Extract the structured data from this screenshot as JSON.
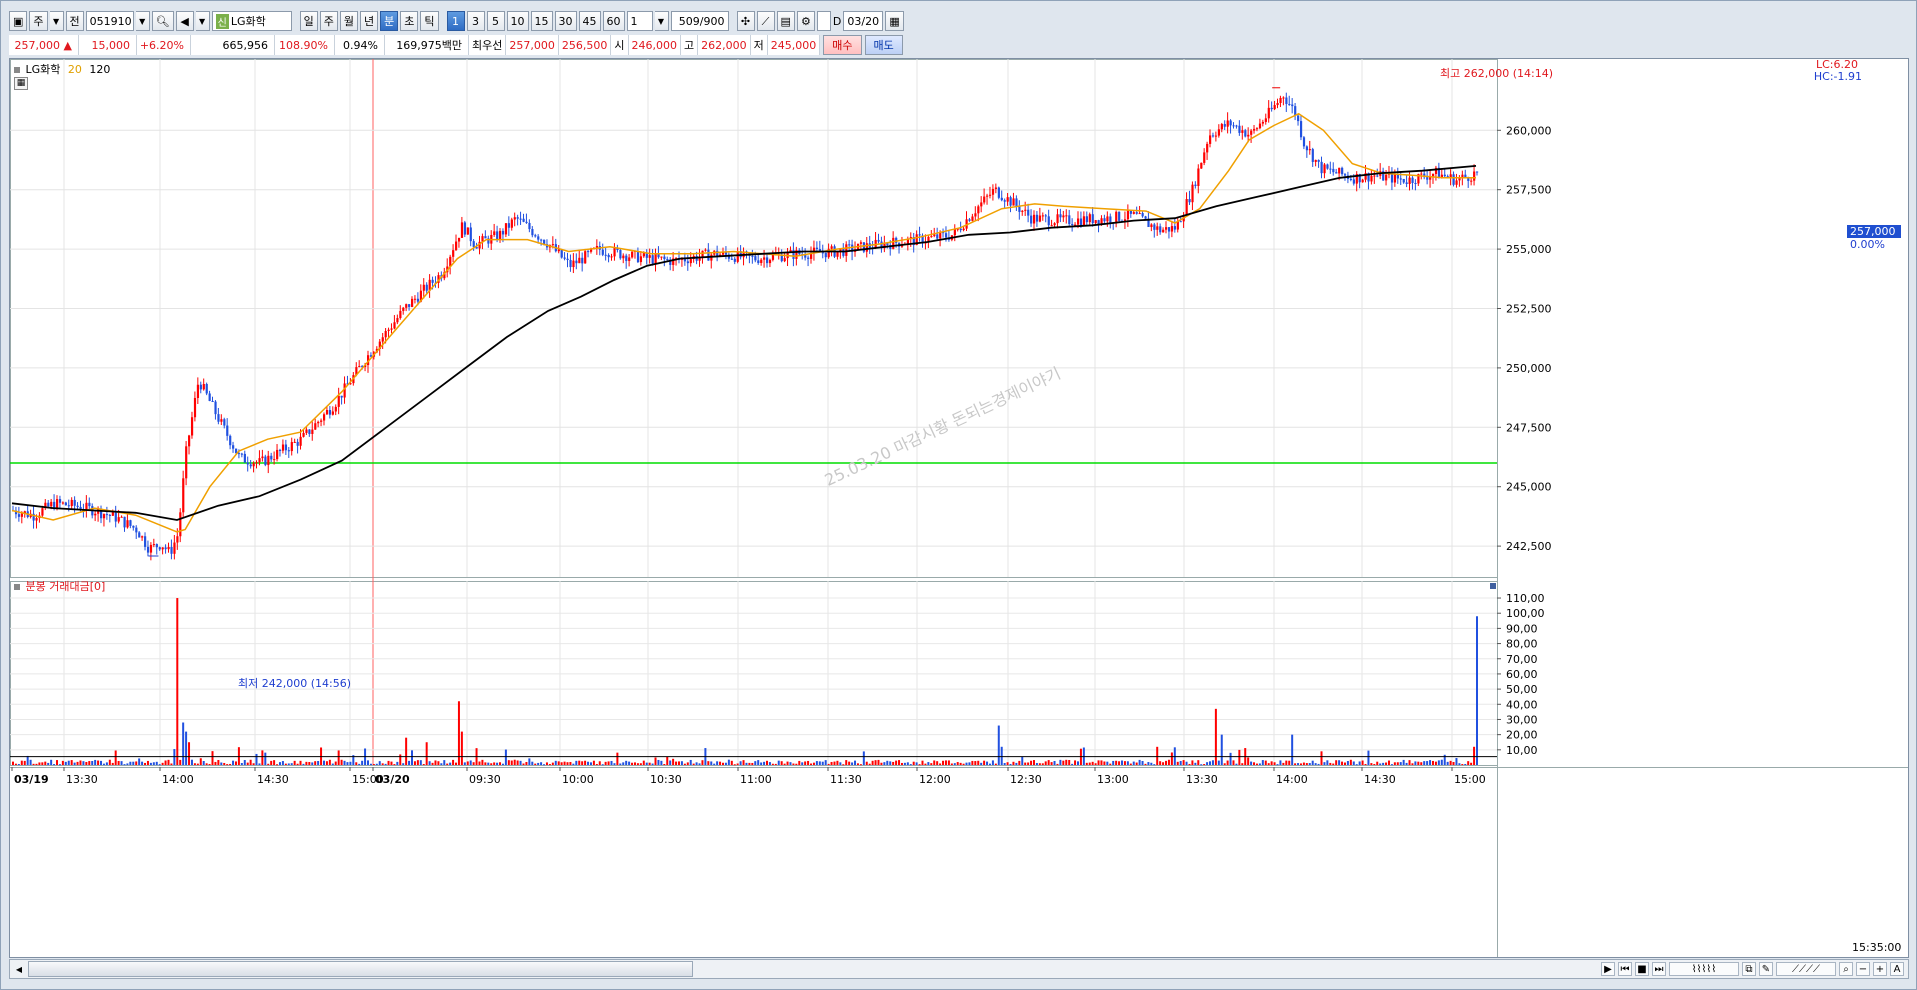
{
  "toolbar": {
    "mode_label": "주",
    "prev_label": "전",
    "stock_code": "051910",
    "stock_badge": "신",
    "stock_name": "LG화학",
    "period_buttons": [
      "일",
      "주",
      "월",
      "년",
      "분",
      "초",
      "틱"
    ],
    "selected_period": "분",
    "interval_buttons": [
      "1",
      "3",
      "5",
      "10",
      "15",
      "30",
      "45",
      "60"
    ],
    "selected_interval": "1",
    "multiplier_value": "1",
    "count_value": "509/900",
    "date_checkbox_label": "D",
    "date_value": "03/20"
  },
  "quote": {
    "price": "257,000 ▲",
    "change": "15,000",
    "change_pct": "+6.20%",
    "volume": "665,956",
    "volume_ratio": "108.90%",
    "turnover_pct": "0.94%",
    "amount": "169,975백만",
    "best_label": "최우선",
    "best_ask": "257,000",
    "best_bid": "256,500",
    "open_label": "시",
    "open": "246,000",
    "high_label": "고",
    "high": "262,000",
    "low_label": "저",
    "low": "245,000",
    "buy_label": "매수",
    "sell_label": "매도"
  },
  "price_panel": {
    "name": "LG화학",
    "ma_short": "20",
    "ma_long": "120",
    "lc_label": "LC:6.20",
    "hc_label": "HC:-1.91",
    "current_tag": "257,000",
    "current_pct": "0.00%",
    "high_annotation": "최고 262,000 (14:14)",
    "low_annotation": "최저 242,000 (14:56)",
    "watermark": "25.03.20 마감시황 돈되는경제이야기",
    "colors": {
      "up": "#ff0000",
      "down": "#2050e0",
      "ma20": "#f0a000",
      "ma120": "#000000",
      "hline": "#00dd00"
    }
  },
  "volume_panel": {
    "title": "분봉 거래대금[0]"
  },
  "time_axis": {
    "labels": [
      "03/19",
      "13:30",
      "14:00",
      "14:30",
      "15:00",
      "03/20",
      "09:30",
      "10:00",
      "10:30",
      "11:00",
      "11:30",
      "12:00",
      "12:30",
      "13:00",
      "13:30",
      "14:00",
      "14:30",
      "15:00"
    ],
    "last_time": "15:35:00"
  },
  "chart_data": {
    "type": "candlestick",
    "price_axis": {
      "ticks": [
        242500,
        245000,
        247500,
        250000,
        252500,
        255000,
        257500,
        260000
      ],
      "labels": [
        "242,500",
        "245,000",
        "247,500",
        "250,000",
        "252,500",
        "255,000",
        "257,500",
        "260,000"
      ],
      "range": [
        241200,
        263000
      ]
    },
    "volume_axis": {
      "ticks": [
        10,
        20,
        30,
        40,
        50,
        60,
        70,
        80,
        90,
        100,
        110
      ],
      "labels": [
        "10,00",
        "20,00",
        "30,00",
        "40,00",
        "50,00",
        "60,00",
        "70,00",
        "80,00",
        "90,00",
        "100,00",
        "110,00"
      ],
      "range": [
        0,
        112
      ]
    },
    "horizontal_line": 246000,
    "price_path": [
      [
        0,
        244000
      ],
      [
        0.05,
        243800
      ],
      [
        0.1,
        244300
      ],
      [
        0.15,
        244200
      ],
      [
        0.2,
        244000
      ],
      [
        0.25,
        243700
      ],
      [
        0.3,
        243200
      ],
      [
        0.33,
        242400
      ],
      [
        0.36,
        242600
      ],
      [
        0.38,
        242200
      ],
      [
        0.4,
        243000
      ],
      [
        0.42,
        246500
      ],
      [
        0.45,
        249500
      ],
      [
        0.5,
        247800
      ],
      [
        0.55,
        246200
      ],
      [
        0.6,
        246000
      ],
      [
        0.7,
        247000
      ],
      [
        0.78,
        248500
      ],
      [
        0.86,
        250500
      ],
      [
        0.95,
        252500
      ],
      [
        1.04,
        254000
      ],
      [
        1.09,
        256000
      ],
      [
        1.12,
        255200
      ],
      [
        1.18,
        255600
      ],
      [
        1.22,
        256300
      ],
      [
        1.3,
        255200
      ],
      [
        1.35,
        254300
      ],
      [
        1.42,
        255000
      ],
      [
        1.5,
        254700
      ],
      [
        1.6,
        254500
      ],
      [
        1.7,
        254800
      ],
      [
        1.8,
        254600
      ],
      [
        1.9,
        254800
      ],
      [
        2.0,
        254900
      ],
      [
        2.1,
        255200
      ],
      [
        2.2,
        255400
      ],
      [
        2.28,
        255600
      ],
      [
        2.33,
        256600
      ],
      [
        2.38,
        257500
      ],
      [
        2.42,
        257000
      ],
      [
        2.47,
        256300
      ],
      [
        2.55,
        256200
      ],
      [
        2.65,
        256300
      ],
      [
        2.72,
        256400
      ],
      [
        2.78,
        255800
      ],
      [
        2.82,
        255900
      ],
      [
        2.86,
        257500
      ],
      [
        2.9,
        259800
      ],
      [
        2.95,
        260300
      ],
      [
        3.0,
        259800
      ],
      [
        3.05,
        260800
      ],
      [
        3.08,
        261500
      ],
      [
        3.11,
        260700
      ],
      [
        3.13,
        259500
      ],
      [
        3.17,
        258400
      ],
      [
        3.25,
        258000
      ],
      [
        3.3,
        258100
      ],
      [
        3.38,
        257900
      ],
      [
        3.45,
        258200
      ],
      [
        3.5,
        257900
      ],
      [
        3.55,
        258200
      ]
    ],
    "ma20_path": [
      [
        0,
        244000
      ],
      [
        0.1,
        243600
      ],
      [
        0.2,
        244100
      ],
      [
        0.3,
        243800
      ],
      [
        0.4,
        243100
      ],
      [
        0.42,
        243200
      ],
      [
        0.48,
        245000
      ],
      [
        0.55,
        246500
      ],
      [
        0.62,
        247000
      ],
      [
        0.7,
        247300
      ],
      [
        0.8,
        249000
      ],
      [
        0.9,
        251000
      ],
      [
        1.0,
        253000
      ],
      [
        1.08,
        254600
      ],
      [
        1.15,
        255400
      ],
      [
        1.25,
        255400
      ],
      [
        1.35,
        254900
      ],
      [
        1.45,
        255100
      ],
      [
        1.55,
        254800
      ],
      [
        1.65,
        254800
      ],
      [
        1.75,
        254900
      ],
      [
        1.9,
        254700
      ],
      [
        2.0,
        255000
      ],
      [
        2.1,
        255200
      ],
      [
        2.2,
        255500
      ],
      [
        2.3,
        255900
      ],
      [
        2.4,
        256700
      ],
      [
        2.48,
        256900
      ],
      [
        2.55,
        256800
      ],
      [
        2.65,
        256700
      ],
      [
        2.75,
        256600
      ],
      [
        2.82,
        256100
      ],
      [
        2.88,
        256700
      ],
      [
        2.95,
        258300
      ],
      [
        3.0,
        259600
      ],
      [
        3.06,
        260200
      ],
      [
        3.12,
        260700
      ],
      [
        3.18,
        260000
      ],
      [
        3.25,
        258600
      ],
      [
        3.32,
        258200
      ],
      [
        3.4,
        258100
      ],
      [
        3.47,
        258000
      ],
      [
        3.55,
        258000
      ]
    ],
    "ma120_path": [
      [
        0,
        244300
      ],
      [
        0.1,
        244100
      ],
      [
        0.2,
        244000
      ],
      [
        0.3,
        243900
      ],
      [
        0.4,
        243600
      ],
      [
        0.5,
        244200
      ],
      [
        0.6,
        244600
      ],
      [
        0.7,
        245300
      ],
      [
        0.8,
        246100
      ],
      [
        0.9,
        247400
      ],
      [
        1.0,
        248700
      ],
      [
        1.1,
        250000
      ],
      [
        1.2,
        251300
      ],
      [
        1.3,
        252400
      ],
      [
        1.38,
        253000
      ],
      [
        1.46,
        253700
      ],
      [
        1.54,
        254300
      ],
      [
        1.62,
        254600
      ],
      [
        1.72,
        254700
      ],
      [
        1.82,
        254800
      ],
      [
        1.92,
        254900
      ],
      [
        2.02,
        254900
      ],
      [
        2.12,
        255100
      ],
      [
        2.22,
        255300
      ],
      [
        2.32,
        255600
      ],
      [
        2.42,
        255700
      ],
      [
        2.52,
        255900
      ],
      [
        2.62,
        256000
      ],
      [
        2.72,
        256200
      ],
      [
        2.82,
        256300
      ],
      [
        2.92,
        256800
      ],
      [
        3.02,
        257200
      ],
      [
        3.12,
        257600
      ],
      [
        3.22,
        258000
      ],
      [
        3.32,
        258200
      ],
      [
        3.42,
        258300
      ],
      [
        3.55,
        258500
      ]
    ],
    "volume_spikes": [
      [
        0.4,
        110
      ],
      [
        0.41,
        28
      ],
      [
        0.42,
        22
      ],
      [
        0.43,
        15
      ],
      [
        1.08,
        42
      ],
      [
        1.09,
        22
      ],
      [
        0.95,
        18
      ],
      [
        1.0,
        15
      ],
      [
        2.39,
        26
      ],
      [
        2.4,
        12
      ],
      [
        2.92,
        37
      ],
      [
        2.93,
        20
      ],
      [
        3.1,
        20
      ],
      [
        3.55,
        98
      ],
      [
        3.54,
        12
      ]
    ]
  }
}
